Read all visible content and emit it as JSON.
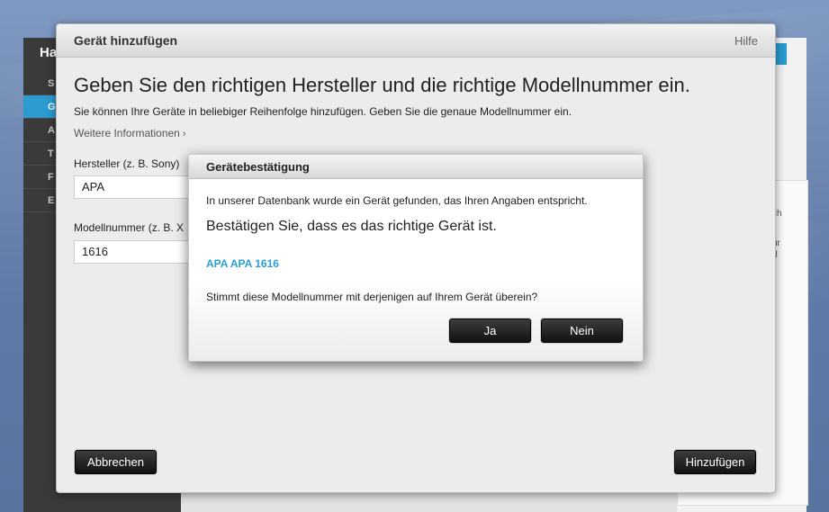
{
  "background": {
    "sidebar_title": "Ha",
    "sidebar_items": [
      "S",
      "G",
      "A",
      "T",
      "F",
      "E"
    ],
    "tab_label": "n",
    "panel_lines": [
      "ch",
      "ür",
      "d"
    ]
  },
  "dialog": {
    "title": "Gerät hinzufügen",
    "help_label": "Hilfe",
    "heading": "Geben Sie den richtigen Hersteller und die richtige Modellnummer ein.",
    "subtitle": "Sie können Ihre Geräte in beliebiger Reihenfolge hinzufügen. Geben Sie die genaue Modellnummer ein.",
    "more_info_label": "Weitere Informationen",
    "manufacturer_label": "Hersteller (z. B. Sony)",
    "manufacturer_value": "APA",
    "model_label": "Modellnummer (z. B. X",
    "model_value": "1616",
    "cancel_label": "Abbrechen",
    "add_label": "Hinzufügen"
  },
  "confirm": {
    "title": "Gerätebestätigung",
    "found_text": "In unserer Datenbank wurde ein Gerät gefunden, das Ihren Angaben entspricht.",
    "confirm_text": "Bestätigen Sie, dass es das richtige Gerät ist.",
    "device_name": "APA APA 1616",
    "question": "Stimmt diese Modellnummer mit derjenigen auf Ihrem Gerät überein?",
    "yes_label": "Ja",
    "no_label": "Nein"
  },
  "colors": {
    "accent": "#2a9fd6",
    "button_dark": "#1a1a1a"
  }
}
